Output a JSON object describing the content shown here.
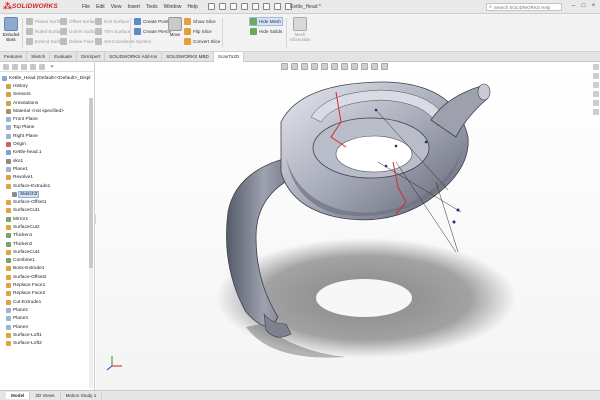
{
  "app": {
    "logo_text": "SOLIDWORKS",
    "document_title": "Kettle_Head *"
  },
  "menu": [
    "File",
    "Edit",
    "View",
    "Insert",
    "Tools",
    "Window",
    "Help"
  ],
  "search": {
    "placeholder": "Search SOLIDWORKS Help"
  },
  "window_controls": [
    "–",
    "□",
    "×"
  ],
  "command_bar": {
    "col1": [
      "Planar Surface",
      "Ruled Surface",
      "Extend Surface"
    ],
    "col2": [
      "Offset Surface",
      "Untrim Surface",
      "Delete Face"
    ],
    "col3": [
      "Knit Surface",
      "Trim Surface",
      "Set Coordinate System"
    ],
    "col4": [
      "Create Points",
      "Create Pierce"
    ],
    "big_left": "Extruded Boss",
    "big_mid": "Move",
    "col5": [
      "Show Slice",
      "Flip Slice",
      "Convert Slice"
    ],
    "col6": [
      "Hide Mesh",
      "Hide Solids"
    ],
    "big_right": "Mesh Information"
  },
  "tabs": [
    "Features",
    "Sketch",
    "Evaluate",
    "DimXpert",
    "SOLIDWORKS Add-Ins",
    "SOLIDWORKS MBD",
    "ScanTo3D"
  ],
  "tabs_active_index": 6,
  "tree": {
    "filter_icon": "funnel-icon",
    "items": [
      {
        "label": "Kettle_Head (Default<<Default>_Displ",
        "icon": "#8aa6c8"
      },
      {
        "label": "History",
        "icon": "#d0a24a"
      },
      {
        "label": "Sensors",
        "icon": "#d0a24a"
      },
      {
        "label": "Annotations",
        "icon": "#d0a24a"
      },
      {
        "label": "Material <not specified>",
        "icon": "#b98b5b"
      },
      {
        "label": "Front Plane",
        "icon": "#9bb4d2"
      },
      {
        "label": "Top Plane",
        "icon": "#9bb4d2"
      },
      {
        "label": "Right Plane",
        "icon": "#9bb4d2"
      },
      {
        "label": "Origin",
        "icon": "#c66"
      },
      {
        "label": "Kettle-head.1",
        "icon": "#7f9fc4"
      },
      {
        "label": "sko1",
        "icon": "#8a8a8a"
      },
      {
        "label": "Plane1",
        "icon": "#9bb4d2"
      },
      {
        "label": "Revolve1",
        "icon": "#e0a23a"
      },
      {
        "label": "Surface-Extrude1",
        "icon": "#e0a23a"
      },
      {
        "label": "Sketch3",
        "icon": "#8a8a8a",
        "selected": true
      },
      {
        "label": "Surface-Offset1",
        "icon": "#e0a23a"
      },
      {
        "label": "SurfaceCut1",
        "icon": "#e0a23a"
      },
      {
        "label": "Mirror1",
        "icon": "#7aa364"
      },
      {
        "label": "SurfaceCut2",
        "icon": "#e0a23a"
      },
      {
        "label": "Thicken1",
        "icon": "#7aa364"
      },
      {
        "label": "Thicken2",
        "icon": "#7aa364"
      },
      {
        "label": "SurfaceCut4",
        "icon": "#e0a23a"
      },
      {
        "label": "Combine1",
        "icon": "#7aa364"
      },
      {
        "label": "Boss-Extrude1",
        "icon": "#e0a23a"
      },
      {
        "label": "Surface-Offset2",
        "icon": "#e0a23a"
      },
      {
        "label": "Replace Face1",
        "icon": "#e0a23a"
      },
      {
        "label": "Replace Face2",
        "icon": "#e0a23a"
      },
      {
        "label": "Cut-Extrude1",
        "icon": "#e0a23a"
      },
      {
        "label": "Plane2",
        "icon": "#9bb4d2"
      },
      {
        "label": "Plane3",
        "icon": "#9bb4d2"
      },
      {
        "label": "Plane4",
        "icon": "#9bb4d2"
      },
      {
        "label": "Surface-Loft1",
        "icon": "#e0a23a"
      },
      {
        "label": "Surface-Loft2",
        "icon": "#e0a23a"
      }
    ]
  },
  "bottom_tabs": [
    "Model",
    "3D Views",
    "Motion Study 1"
  ],
  "bottom_active_index": 0,
  "colors": {
    "brand": "#d8241f",
    "selection": "#cfe2f8",
    "sketch_red": "#d92a2a"
  }
}
